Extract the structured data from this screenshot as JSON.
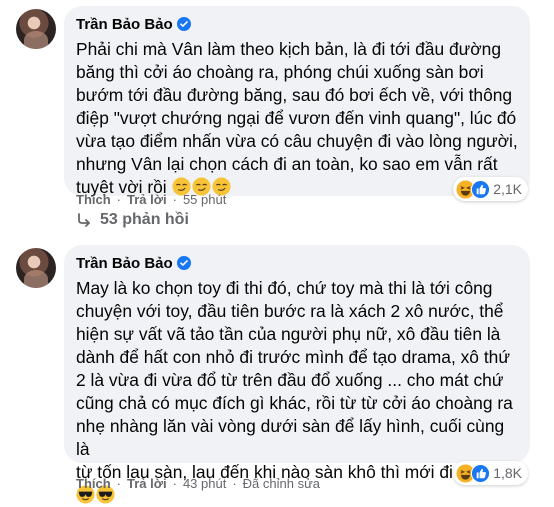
{
  "comments": [
    {
      "author": "Trần Bảo Bảo",
      "text": "Phải chi mà Vân làm theo kịch bản, là đi tới đầu đường\nbăng thì cởi áo choàng ra, phóng chúi xuống sàn bơi\nbướm tới đầu đường băng, sau đó bơi ếch về, với thông\nđiệp \"vượt chướng ngại để vươn đến vinh quang\", lúc đó\nvừa tạo điểm nhấn vừa có câu chuyện đi vào lòng người,\nnhưng Vân lại chọn cách đi an toàn, ko sao em vẫn rất\ntuyệt vời rồi",
      "trailing_emojis": [
        "smirk-emoji",
        "smirk-emoji",
        "smirk-emoji"
      ],
      "reaction_count": "2,1K",
      "reactions": [
        "haha-reaction-icon",
        "like-reaction-icon"
      ],
      "actions": {
        "like": "Thích",
        "reply": "Trả lời",
        "time": "55 phút"
      }
    },
    {
      "author": "Trần Bảo Bảo",
      "text": "May là ko chọn toy đi thi đó, chứ toy mà thi là tới công\nchuyện với toy, đầu tiên bước ra là xách 2 xô nước, thể\nhiện sự vất vã tảo tần của người phụ nữ, xô đầu tiên là\ndành để hất con nhỏ đi trước mình để tạo drama, xô thứ\n2 là vừa đi vừa đổ từ trên đầu đổ xuống ... cho mát chứ\ncũng chả có mục đích gì khác, rồi từ từ cởi áo choàng ra\nnhẹ nhàng lăn vài vòng dưới sàn để lấy hình, cuối cùng là\ntừ tốn lau sàn, lau đến khi nào sàn khô thì mới đi vào",
      "trailing_emojis": [
        "sunglasses-emoji"
      ],
      "extra_line_emojis": [
        "sunglasses-emoji",
        "sunglasses-emoji"
      ],
      "reaction_count": "1,8K",
      "reactions": [
        "haha-reaction-icon",
        "like-reaction-icon"
      ],
      "actions": {
        "like": "Thích",
        "reply": "Trả lời",
        "time": "43 phút",
        "edited": "Đã chỉnh sửa"
      }
    }
  ],
  "replies_link": "53 phản hồi",
  "colors": {
    "bubble": "#f0f2f5",
    "muted": "#65676b",
    "verified": "#1877f2",
    "like": "#1877f2",
    "haha": "#f7b125"
  }
}
